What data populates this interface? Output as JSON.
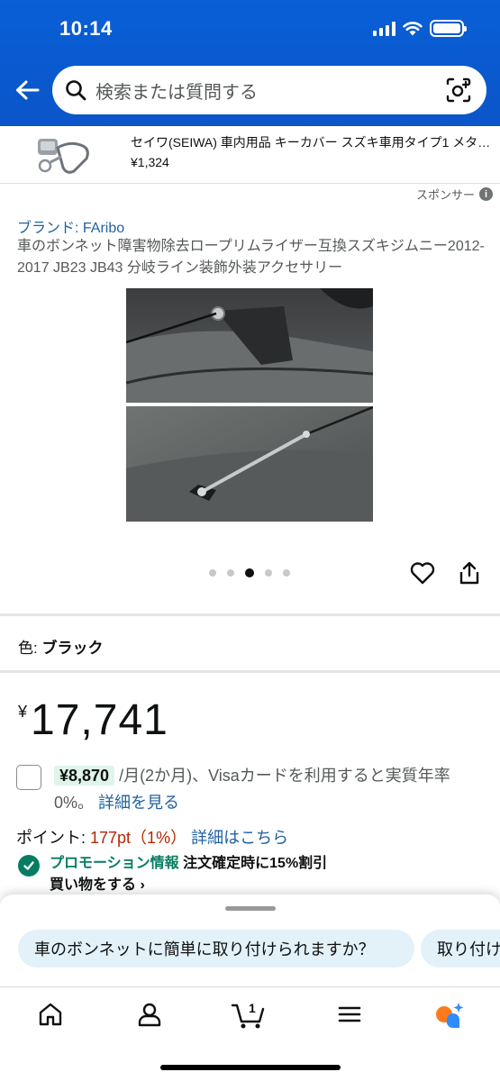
{
  "status_bar": {
    "time": "10:14"
  },
  "search": {
    "placeholder": "検索または質問する"
  },
  "sponsored": {
    "title": "セイワ(SEIWA) 車内用品 キーカバー スズキ車用タイプ1 メタ…",
    "price": "¥1,324",
    "label": "スポンサー"
  },
  "product": {
    "brand": "ブランド: FAribo",
    "title": "車のボンネット障害物除去ロープリムライザー互換スズキジムニー2012-2017 JB23 JB43 分岐ライン装飾外装アクセサリー",
    "image_count": 5,
    "image_active_index": 2
  },
  "color": {
    "label": "色: ",
    "value": "ブラック"
  },
  "price": {
    "symbol": "¥",
    "amount": "17,741"
  },
  "installment": {
    "amount": "¥8,870",
    "text": " /月(2か月)、Visaカードを利用すると実質年率0%。",
    "link": "詳細を見る"
  },
  "points": {
    "label": "ポイント: ",
    "value": "177pt（1%）",
    "link": "詳細はこちら"
  },
  "promo": {
    "label": "プロモーション情報",
    "detail": "注文確定時に15%割引",
    "link": "買い物をする ›"
  },
  "suggestions": [
    "車のボンネットに簡単に取り付けられますか？",
    "取り付け"
  ],
  "bottom_nav": {
    "items": [
      "home-icon",
      "account-icon",
      "cart-icon",
      "menu-icon",
      "rufus-icon"
    ],
    "cart_count": "1"
  },
  "colors": {
    "header_blue": "#0a58ca",
    "link_blue": "#2162a1",
    "price_red": "#b12704",
    "promo_green": "#067d62",
    "chip_bg": "#e3f1f9"
  }
}
